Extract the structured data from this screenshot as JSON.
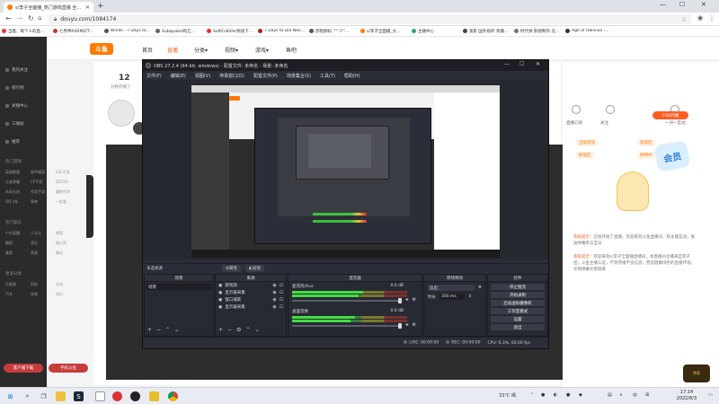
{
  "browser": {
    "tab_title": "s/李子全面播_热门游戏直播 全...",
    "url": "douyu.com/1084174",
    "bookmarks": [
      {
        "label": "当着，每个人的直...",
        "color": "#e33"
      },
      {
        "label": "七界神ASRMD下...",
        "color": "#c33"
      },
      {
        "label": "Winds - 7 Days to...",
        "color": "#555"
      },
      {
        "label": "Subqualed的汇...",
        "color": "#666"
      },
      {
        "label": "SoftCnKiller频道下...",
        "color": "#d33"
      },
      {
        "label": "7 Days to Die Nex...",
        "color": "#a22"
      },
      {
        "label": "挤唱频码「°·ツ°...",
        "color": "#555"
      },
      {
        "label": "s/李子全面播_大...",
        "color": "#ff7a00"
      },
      {
        "label": "主播中心",
        "color": "#2a7"
      },
      {
        "label": "鬼影 国外视听 英播...",
        "color": "#444"
      },
      {
        "label": "时代帅 影视制作 北...",
        "color": "#777"
      },
      {
        "label": "Age of Oblivion -...",
        "color": "#333"
      }
    ]
  },
  "douyu": {
    "logo": "斗鱼",
    "nav": [
      {
        "label": "首页",
        "active": false
      },
      {
        "label": "直播",
        "active": true
      },
      {
        "label": "分类▾",
        "active": false
      },
      {
        "label": "视频▾",
        "active": false
      },
      {
        "label": "游戏▾",
        "active": false
      },
      {
        "label": "鱼吧",
        "active": false
      }
    ],
    "sidebar": {
      "items": [
        "我的关注",
        "排行榜",
        "关播中心",
        "三维剧",
        "推荐"
      ],
      "sections": [
        {
          "title": "热门游戏",
          "items": [
            "英雄联盟",
            "和平精英",
            "LOL手游",
            "王者荣耀",
            "CF手游",
            "DOTA2",
            "永劫无间",
            "传奇手游",
            "魔兽世界",
            "QQ飞车",
            "原神",
            "一起看"
          ]
        },
        {
          "title": "热门娱乐",
          "items": [
            "户外直播",
            "二次元",
            "颜值",
            "舞蹈",
            "音乐",
            "脱口秀",
            "美食",
            "萌宠",
            "数码"
          ]
        },
        {
          "title": "更多分类",
          "items": [
            "正能量",
            "科技",
            "文化",
            "汽车",
            "体育",
            "知识"
          ]
        }
      ],
      "footer_buttons": [
        "客户端下载",
        "手机斗鱼"
      ]
    },
    "room": {
      "follow_count": "12",
      "follow_label": "分钟开播了"
    },
    "right_panel": {
      "buttons": [
        "直播订阅",
        "关注",
        "一对一互动"
      ],
      "pill": "FOR开播",
      "tags": [
        "全能游戏",
        "游戏区",
        "颜值区",
        "拼搏中"
      ],
      "chat": [
        {
          "name": "系统提示：",
          "body": "已经开始了直播，欢迎来到斗鱼直播间，和主播互动，发送弹幕参与互动"
        },
        {
          "name": "系统提示：",
          "body": "欢迎来到s/李子全面播直播间，本直播间主播来自李子团，斗鱼主播认证，严禁传播不良信息，营造健康绿色的直播环境，文明弹幕文明观看"
        }
      ]
    }
  },
  "obs": {
    "title": "OBS 27.2.4 (64-bit, windows) - 配置文件: 未命名 - 场景: 未命名",
    "menu": [
      "文件(F)",
      "编辑(E)",
      "视图(V)",
      "停靠窗口(D)",
      "配置文件(P)",
      "场景集合(S)",
      "工具(T)",
      "帮助(H)"
    ],
    "scene_bar": {
      "name": "未选择源",
      "props": "⚙属性",
      "filters": "◐滤镜"
    },
    "docks": {
      "scenes": {
        "title": "场景",
        "items": [
          "场景"
        ]
      },
      "sources": {
        "title": "来源",
        "items": [
          "游戏源",
          "显示器采集",
          "窗口捕获",
          "显示器采集"
        ]
      },
      "mixer": {
        "title": "混音器",
        "channels": [
          {
            "name": "麦克风/Aux",
            "db": "0.0 dB",
            "level": 0.62
          },
          {
            "name": "桌面音频",
            "db": "0.0 dB",
            "level": 0.55
          }
        ]
      },
      "transitions": {
        "title": "转场特效",
        "type": "淡出",
        "duration_label": "时长",
        "duration": "300 ms"
      },
      "controls": {
        "title": "控件",
        "buttons": [
          "停止推流",
          "开始录制",
          "启动虚拟摄像机",
          "工作室模式",
          "设置",
          "退出"
        ]
      }
    },
    "status": {
      "live": "LIVE: 00:00:00",
      "rec": "REC: 00:00:00",
      "cpu": "CPU: 6.3%, 60.00 fps"
    }
  },
  "taskbar": {
    "weather": "33°C 晴",
    "time": "17:14",
    "date": "2022/6/3"
  }
}
